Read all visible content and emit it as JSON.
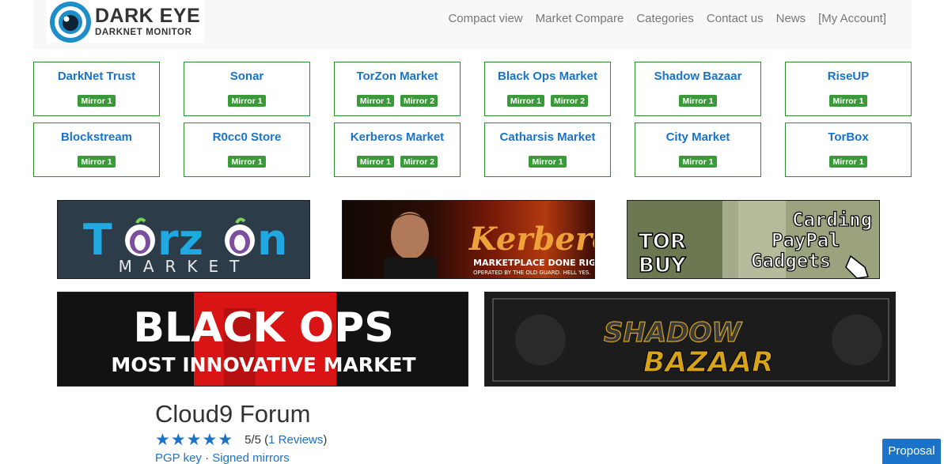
{
  "logo": {
    "title": "DARK EYE",
    "subtitle": "DARKNET MONITOR"
  },
  "nav": [
    "Compact view",
    "Market Compare",
    "Categories",
    "Contact us",
    "News",
    "[My Account]"
  ],
  "markets": [
    {
      "name": "DarkNet Trust",
      "mirrors": [
        "Mirror 1"
      ]
    },
    {
      "name": "Sonar",
      "mirrors": [
        "Mirror 1"
      ]
    },
    {
      "name": "TorZon Market",
      "mirrors": [
        "Mirror 1",
        "Mirror 2"
      ]
    },
    {
      "name": "Black Ops Market",
      "mirrors": [
        "Mirror 1",
        "Mirror 2"
      ]
    },
    {
      "name": "Shadow Bazaar",
      "mirrors": [
        "Mirror 1"
      ]
    },
    {
      "name": "RiseUP",
      "mirrors": [
        "Mirror 1"
      ]
    },
    {
      "name": "Blockstream",
      "mirrors": [
        "Mirror 1"
      ]
    },
    {
      "name": "R0cc0 Store",
      "mirrors": [
        "Mirror 1"
      ]
    },
    {
      "name": "Kerberos Market",
      "mirrors": [
        "Mirror 1",
        "Mirror 2"
      ]
    },
    {
      "name": "Catharsis Market",
      "mirrors": [
        "Mirror 1"
      ]
    },
    {
      "name": "City Market",
      "mirrors": [
        "Mirror 1"
      ]
    },
    {
      "name": "TorBox",
      "mirrors": [
        "Mirror 1"
      ]
    }
  ],
  "banners": {
    "torzon": {
      "text1": "T",
      "text2": "rz",
      "text3": "n",
      "sub": "MARKET"
    },
    "kerberos": {
      "script": "Kerberos",
      "line1": "MARKETPLACE DONE RIGHT.",
      "line2": "OPERATED BY THE OLD GUARD. HELL YES."
    },
    "torbuy": {
      "tor": "TOR",
      "buy": "BUY",
      "l1": "Carding",
      "l2": "PayPal",
      "l3": "Gadgets"
    },
    "blackops": {
      "line1": "BLACK OPS",
      "line2": "MOST INNOVATIVE MARKET"
    },
    "shadow": {
      "l1": "SHADOW",
      "l2": "BAZAAR"
    }
  },
  "listing": {
    "title": "Cloud9 Forum",
    "stars": "★★★★★",
    "rating": "5/5",
    "reviews": "1 Reviews",
    "pgp": "PGP key",
    "separator": "·",
    "signed": "Signed mirrors"
  },
  "proposal_label": "Proposal",
  "colors": {
    "accent": "#1a73c8",
    "mirror": "#3a9a3a",
    "border": "#2e8b2e"
  }
}
